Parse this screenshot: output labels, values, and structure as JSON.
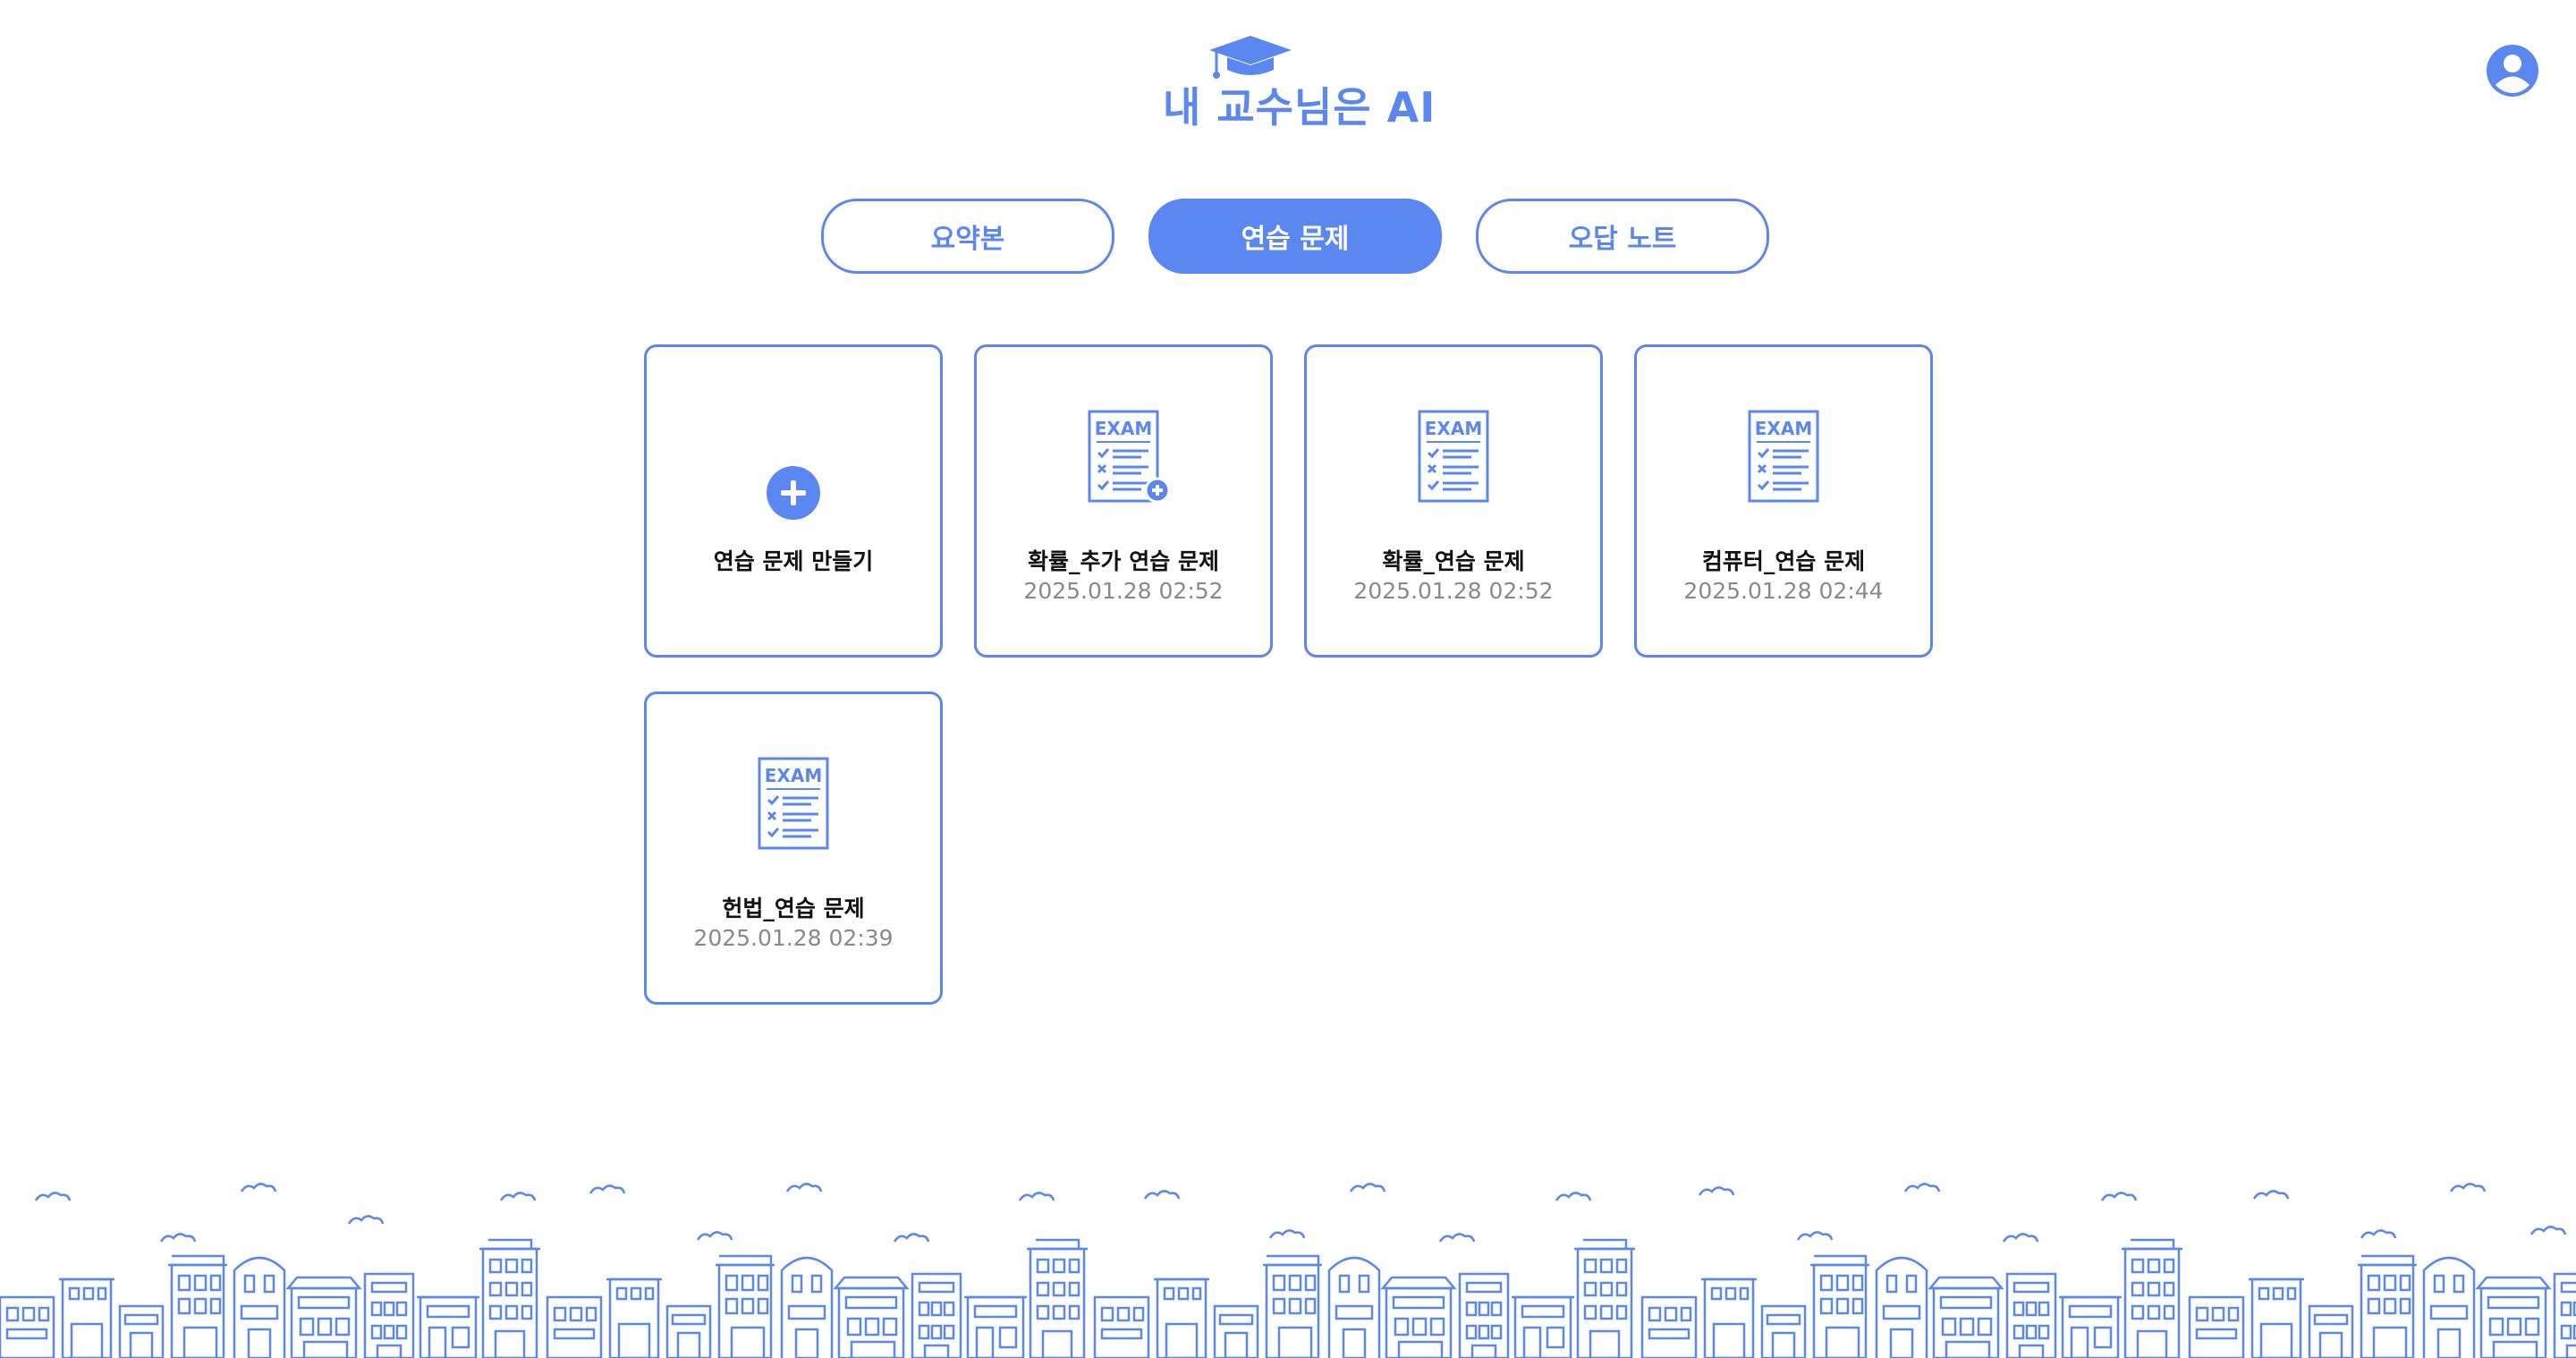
{
  "header": {
    "logo_text": "내 교수님은 AI"
  },
  "tabs": [
    {
      "label": "요약본",
      "active": false
    },
    {
      "label": "연습 문제",
      "active": true
    },
    {
      "label": "오답 노트",
      "active": false
    }
  ],
  "cards": {
    "create": {
      "label": "연습 문제 만들기"
    },
    "items": [
      {
        "title": "확률_추가 연습 문제",
        "date": "2025.01.28 02:52",
        "icon_badge": "plus"
      },
      {
        "title": "확률_연습 문제",
        "date": "2025.01.28 02:52"
      },
      {
        "title": "컴퓨터_연습 문제",
        "date": "2025.01.28 02:44"
      },
      {
        "title": "헌법_연습 문제",
        "date": "2025.01.28 02:39"
      }
    ],
    "exam_icon_label": "EXAM"
  },
  "colors": {
    "accent": "#5b87f0",
    "text": "#111111",
    "muted": "#8a8a8a"
  },
  "icons": [
    "graduation-cap-icon",
    "profile-icon",
    "plus-circle-icon",
    "exam-document-icon",
    "city-skyline-illustration"
  ]
}
